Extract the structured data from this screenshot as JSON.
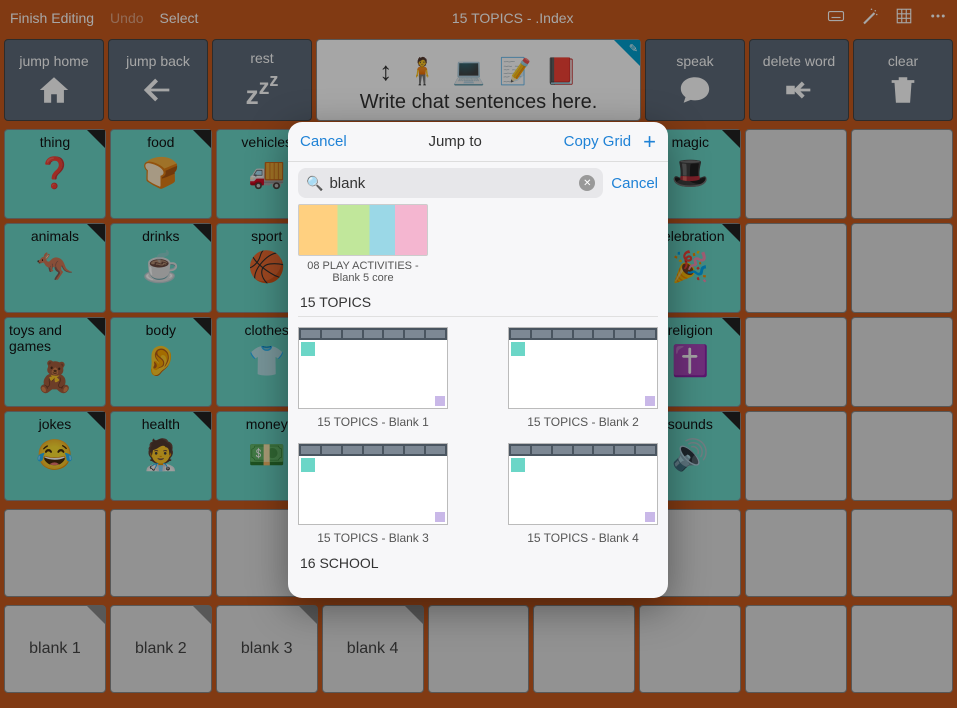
{
  "topbar": {
    "finish": "Finish Editing",
    "undo": "Undo",
    "select": "Select",
    "title": "15 TOPICS - .Index"
  },
  "actions": {
    "jump_home": "jump home",
    "jump_back": "jump back",
    "rest": "rest",
    "speak": "speak",
    "delete_word": "delete word",
    "clear": "clear"
  },
  "chat": {
    "prompt": "Write chat sentences here."
  },
  "cells": {
    "r1": [
      "thing",
      "food",
      "vehicles",
      "",
      "",
      "",
      "magic",
      "",
      ""
    ],
    "r2": [
      "animals",
      "drinks",
      "sport",
      "",
      "",
      "",
      "celebration",
      "",
      ""
    ],
    "r3": [
      "toys and games",
      "body",
      "clothes",
      "",
      "",
      "",
      "religion",
      "",
      ""
    ],
    "r4": [
      "jokes",
      "health",
      "money",
      "",
      "",
      "",
      "sounds",
      "",
      ""
    ]
  },
  "blank_row": [
    "blank 1",
    "blank 2",
    "blank 3",
    "blank 4",
    "",
    "",
    "",
    "",
    ""
  ],
  "modal": {
    "cancel": "Cancel",
    "title": "Jump to",
    "copy": "Copy Grid",
    "search_value": "blank",
    "search_cancel": "Cancel",
    "res0": "08 PLAY ACTIVITIES - Blank 5 core",
    "section1": "15 TOPICS",
    "r1": "15 TOPICS - Blank 1",
    "r2": "15 TOPICS - Blank 2",
    "r3": "15 TOPICS - Blank 3",
    "r4": "15 TOPICS - Blank 4",
    "section2": "16 SCHOOL"
  }
}
